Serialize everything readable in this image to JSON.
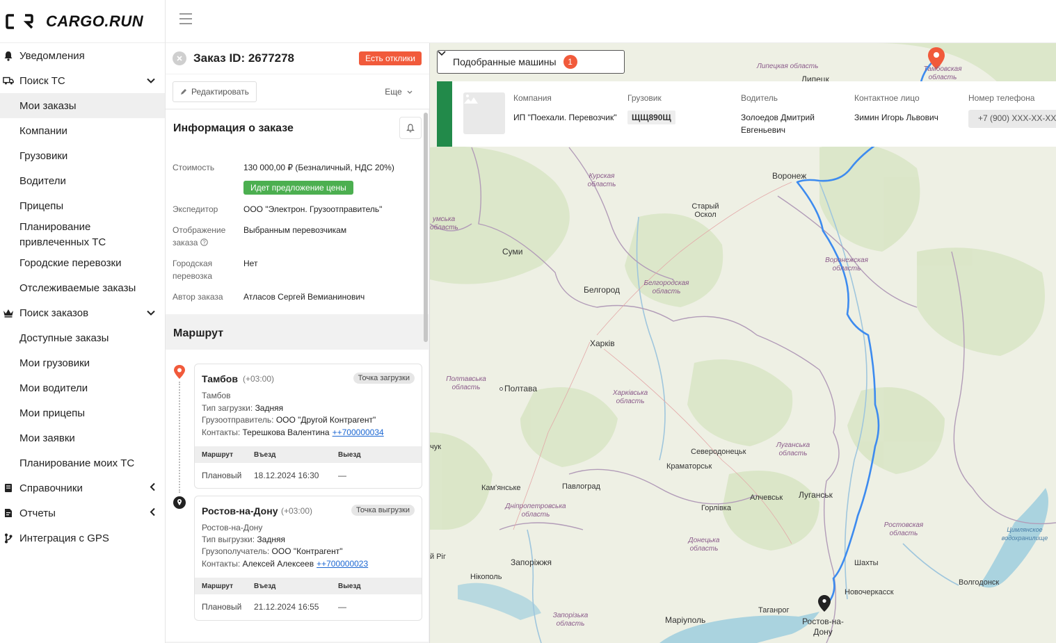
{
  "app": {
    "logo_text": "CARGO.RUN"
  },
  "sidebar": {
    "items": [
      {
        "label": "Уведомления",
        "icon": "bell-icon",
        "type": "top"
      },
      {
        "label": "Поиск ТС",
        "icon": "truck-icon",
        "type": "top",
        "chevron": "down"
      },
      {
        "label": "Мои заказы",
        "type": "sub",
        "active": true
      },
      {
        "label": "Компании",
        "type": "sub"
      },
      {
        "label": "Грузовики",
        "type": "sub"
      },
      {
        "label": "Водители",
        "type": "sub"
      },
      {
        "label": "Прицепы",
        "type": "sub"
      },
      {
        "label": "Планирование привлеченных ТС",
        "type": "sub"
      },
      {
        "label": "Городские перевозки",
        "type": "sub"
      },
      {
        "label": "Отслеживаемые заказы",
        "type": "sub"
      },
      {
        "label": "Поиск заказов",
        "icon": "crown-icon",
        "type": "top",
        "chevron": "down"
      },
      {
        "label": "Доступные заказы",
        "type": "sub"
      },
      {
        "label": "Мои грузовики",
        "type": "sub"
      },
      {
        "label": "Мои водители",
        "type": "sub"
      },
      {
        "label": "Мои прицепы",
        "type": "sub"
      },
      {
        "label": "Мои заявки",
        "type": "sub"
      },
      {
        "label": "Планирование моих ТС",
        "type": "sub"
      },
      {
        "label": "Справочники",
        "icon": "book-icon",
        "type": "top",
        "chevron": "left"
      },
      {
        "label": "Отчеты",
        "icon": "report-icon",
        "type": "top",
        "chevron": "left"
      },
      {
        "label": "Интеграция с GPS",
        "icon": "branch-icon",
        "type": "top"
      }
    ]
  },
  "order": {
    "title": "Заказ ID: 2677278",
    "responses_badge": "Есть отклики",
    "edit_label": "Редактировать",
    "more_label": "Еще",
    "info_title": "Информация о заказе",
    "cost_label": "Стоимость",
    "cost_value": "130 000,00 ₽ (Безналичный, НДС 20%)",
    "price_offer_badge": "Идет предложение цены",
    "forwarder_label": "Экспедитор",
    "forwarder_value": "ООО \"Электрон. Грузоотправитель\"",
    "display_label_1": "Отображение",
    "display_label_2": "заказа",
    "display_value": "Выбранным перевозчикам",
    "city_label_1": "Городская",
    "city_label_2": "перевозка",
    "city_value": "Нет",
    "author_label": "Автор заказа",
    "author_value": "Атласов Сергей Вемианинович",
    "route_title": "Маршрут"
  },
  "route": {
    "table_headers": {
      "route": "Маршрут",
      "entry": "Въезд",
      "exit": "Выезд"
    },
    "stops": [
      {
        "city": "Тамбов",
        "tz": "(+03:00)",
        "tag": "Точка загрузки",
        "address": "Тамбов",
        "type_label": "Тип загрузки:",
        "type_value": "Задняя",
        "party_label": "Грузоотправитель:",
        "party_value": "ООО \"Другой Контрагент\"",
        "contacts_label": "Контакты:",
        "contacts_value": "Терешкова Валентина",
        "phone": "++700000034",
        "plan_label": "Плановый",
        "entry": "18.12.2024 16:30",
        "exit": "—"
      },
      {
        "city": "Ростов-на-Дону",
        "tz": "(+03:00)",
        "tag": "Точка выгрузки",
        "address": "Ростов-на-Дону",
        "type_label": "Тип выгрузки:",
        "type_value": "Задняя",
        "party_label": "Грузополучатель:",
        "party_value": "ООО \"Контрагент\"",
        "contacts_label": "Контакты:",
        "contacts_value": "Алексей Алексеев",
        "phone": "++700000023",
        "plan_label": "Плановый",
        "entry": "21.12.2024 16:55",
        "exit": "—"
      }
    ]
  },
  "machines": {
    "button_label": "Подобранные машины",
    "count": "1",
    "headers": {
      "company": "Компания",
      "truck": "Грузовик",
      "driver": "Водитель",
      "contact": "Контактное лицо",
      "phone": "Номер телефона"
    },
    "row": {
      "company": "ИП \"Поехали. Перевозчик\"",
      "truck": "ЩЩ890Щ",
      "driver_1": "Золоедов Дмитрий",
      "driver_2": "Евгеньевич",
      "contact": "Зимин Игорь Львович",
      "phone": "+7 (900) XXX-XX-XX"
    },
    "accent_color": "#228a4a"
  },
  "map": {
    "labels": {
      "lipetsk_region": "Липецкая область",
      "lipetsk": "Липецк",
      "tambov_region": "Тамбовская область",
      "kursk_region": "Курская область",
      "voronezh": "Воронеж",
      "stary_oskol": "Старый Оскол",
      "sumy_region": "умська область",
      "sumy": "Суми",
      "voronezh_region": "Воронежская область",
      "belgorod": "Белгород",
      "belgorod_region": "Белгородская область",
      "kharkiv": "Харків",
      "poltava_region": "Полтавська область",
      "poltava": "Полтава",
      "kharkiv_region": "Харківська область",
      "chuk": "чук",
      "severodonetsk": "Северодонецьк",
      "luhansk_region": "Луганська область",
      "kramatorsk": "Краматорськ",
      "kamianske": "Кам'янське",
      "pavlohrad": "Павлоград",
      "alchevsk": "Алчевськ",
      "luhansk": "Луганськ",
      "horlivka": "Горлівка",
      "dnipro_region": "Дніпропетровська область",
      "rostov_region": "Ростовская область",
      "tsimlyansk": "Цимлянское водохранилище",
      "donetsk_region": "Донецька область",
      "kryvyi_rih": "й Рiг",
      "zaporizhzhia": "Запоріжжя",
      "shakhty": "Шахты",
      "nikopol": "Нікополь",
      "novocherkassk": "Новочеркасск",
      "volgodonsk": "Волгодонск",
      "zaporizhzhia_region": "Запорізька область",
      "mariupol": "Маріуполь",
      "taganrog": "Таганрог",
      "rostov": "Ростов-на-Дону"
    },
    "route_color": "#3d8bef"
  }
}
